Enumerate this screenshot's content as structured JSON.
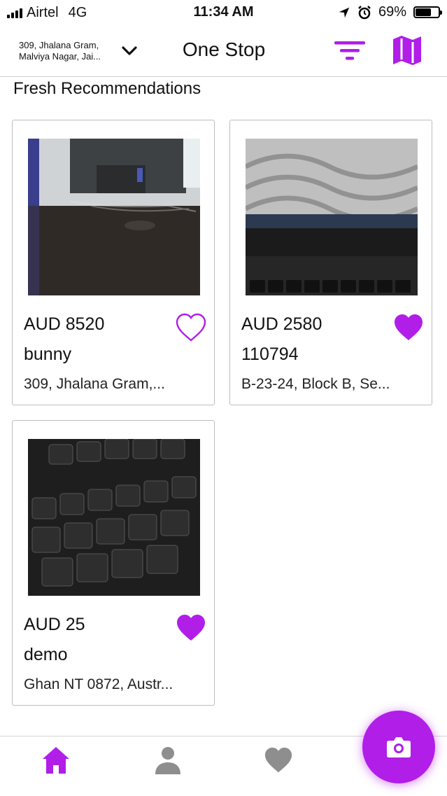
{
  "status_bar": {
    "carrier": "Airtel",
    "network": "4G",
    "time": "11:34 AM",
    "battery": "69%",
    "battery_level": 0.69
  },
  "header": {
    "location_line1": "309, Jhalana Gram,",
    "location_line2": "Malviya Nagar, Jai...",
    "title": "One Stop",
    "icons": [
      "chevron-down-icon",
      "filter-icon",
      "map-icon"
    ]
  },
  "section_title": "Fresh Recommendations",
  "listings": [
    {
      "price": "AUD 8520",
      "name": "bunny",
      "address": "309, Jhalana Gram,...",
      "favorited": false,
      "image": "desktop monitor on a desk"
    },
    {
      "price": "AUD 2580",
      "name": "110794",
      "address": "B-23-24, Block B, Se...",
      "favorited": true,
      "image": "laptop screen and function keys"
    },
    {
      "price": "AUD 25",
      "name": "demo",
      "address": "Ghan NT 0872, Austr...",
      "favorited": true,
      "image": "laptop keyboard close-up"
    }
  ],
  "bottom_nav": {
    "items": [
      "home-icon",
      "profile-icon",
      "favorites-icon"
    ],
    "active": "home-icon",
    "fab": "camera-icon"
  },
  "colors": {
    "accent": "#b01ee8",
    "inactive_icon": "#8e8e8e",
    "divider": "#cfcfcf"
  }
}
